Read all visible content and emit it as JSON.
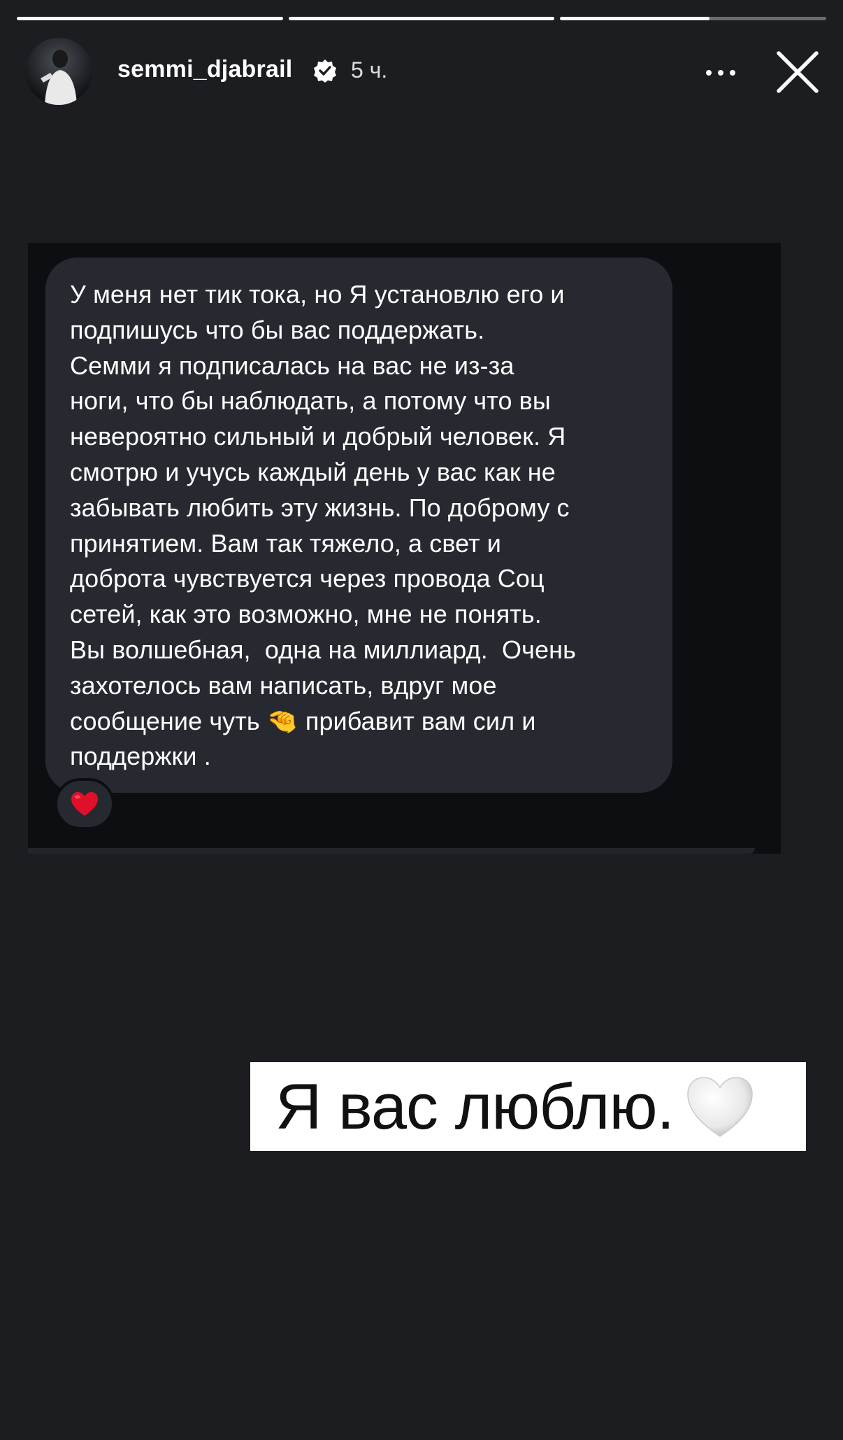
{
  "progress": [
    {
      "fill": 1.0
    },
    {
      "fill": 1.0
    },
    {
      "fill": 0.56
    }
  ],
  "header": {
    "username": "semmi_djabrail",
    "verified": true,
    "time": "5 ч.",
    "avatar_icon": "profile-avatar",
    "more_icon": "more-horizontal-icon",
    "close_icon": "close-icon"
  },
  "message": {
    "text": "У меня нет тик тока, но Я установлю его и\nподпишусь что бы вас поддержать.\nСемми я подписалась на вас не из-за\nноги, что бы наблюдать, а потому что вы\nневероятно сильный и добрый человек. Я\nсмотрю и учусь каждый день у вас как не\nзабывать любить эту жизнь. По доброму с\nпринятием. Вам так тяжело, а свет и\nдоброта чувствуется через провода Соц\nсетей, как это возможно, мне не понять.\nВы волшебная,  одна на миллиард.  Очень\nзахотелось вам написать, вдруг мое\nсообщение чуть 🤏 прибавит вам сил и\nподдержки .",
    "reaction": "❤️"
  },
  "sticker": {
    "text": "Я вас люблю.",
    "emoji": "white-heart"
  },
  "colors": {
    "background": "#1b1d21",
    "card": "#0c0e12",
    "bubble": "#262a30",
    "heart_red": "#e0102a",
    "sticker_bg": "#ffffff"
  }
}
